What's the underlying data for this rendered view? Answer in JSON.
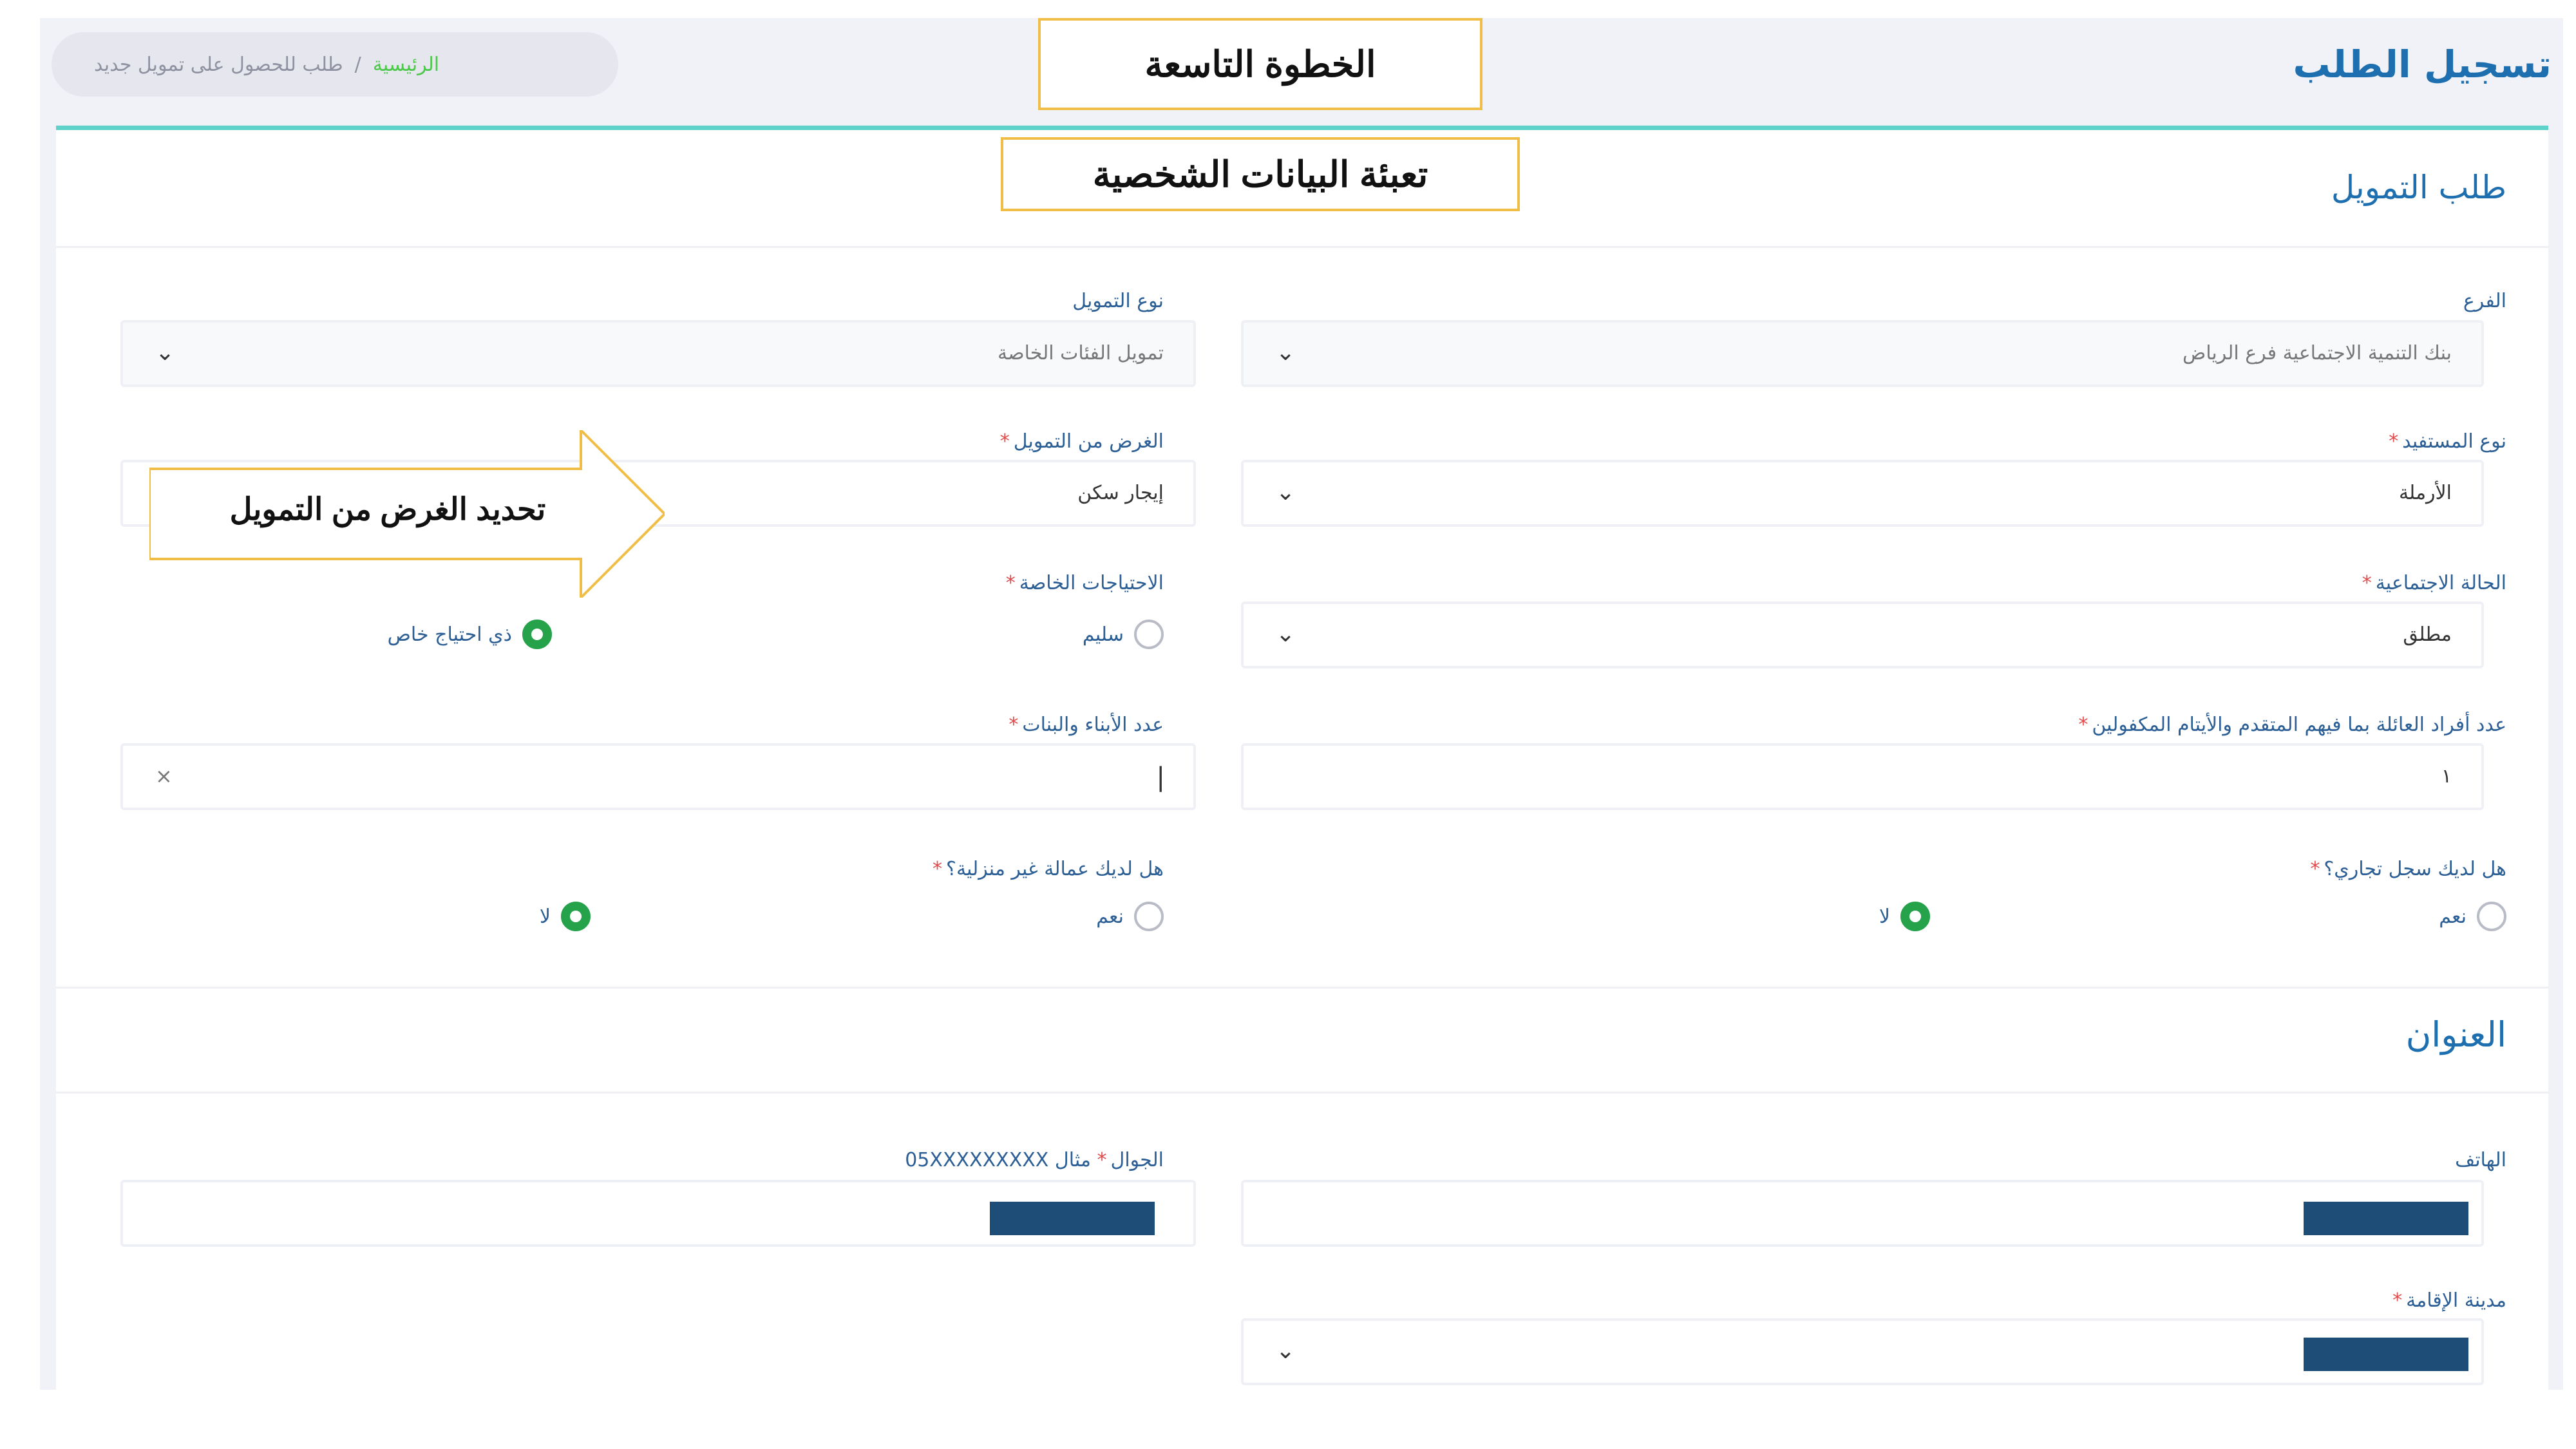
{
  "header": {
    "page_title": "تسجيل الطلب",
    "breadcrumb": {
      "home": "الرئيسية",
      "separator": "/",
      "current": "طلب للحصول على تمويل جديد"
    }
  },
  "annotations": {
    "step": "الخطوة التاسعة",
    "section_note": "تعبئة البيانات الشخصية",
    "arrow_note": "تحديد الغرض من التمويل"
  },
  "form": {
    "section_title": "طلب التمويل",
    "branch": {
      "label": "الفرع",
      "value": "بنك التنمية الاجتماعية فرع الرياض"
    },
    "financing_type": {
      "label": "نوع التمويل",
      "value": "تمويل الفئات الخاصة"
    },
    "beneficiary_type": {
      "label": "نوع المستفيد",
      "required": "*",
      "value": "الأرملة"
    },
    "financing_purpose": {
      "label": "الغرض من التمويل",
      "required": "*",
      "value": "إيجار سكن"
    },
    "marital_status": {
      "label": "الحالة الاجتماعية",
      "required": "*",
      "value": "مطلق"
    },
    "special_needs": {
      "label": "الاحتياجات الخاصة",
      "required": "*",
      "options": [
        {
          "label": "سليم",
          "selected": false
        },
        {
          "label": "ذي احتياج خاص",
          "selected": true
        }
      ]
    },
    "family_members": {
      "label": "عدد أفراد العائلة بما فيهم المتقدم والأيتام المكفولين",
      "required": "*",
      "value": "١"
    },
    "children_count": {
      "label": "عدد الأبناء والبنات",
      "required": "*",
      "value": "",
      "clear_icon": "×"
    },
    "commercial_register": {
      "label": "هل لديك سجل تجاري؟",
      "required": "*",
      "options": [
        {
          "label": "نعم",
          "selected": false
        },
        {
          "label": "لا",
          "selected": true
        }
      ]
    },
    "domestic_worker": {
      "label": "هل لديك عمالة غير منزلية؟",
      "required": "*",
      "options": [
        {
          "label": "نعم",
          "selected": false
        },
        {
          "label": "لا",
          "selected": true
        }
      ]
    }
  },
  "address": {
    "section_title": "العنوان",
    "phone": {
      "label": "الهاتف"
    },
    "mobile": {
      "label": "الجوال",
      "required": "*",
      "hint": "مثال 05XXXXXXXXX"
    },
    "city": {
      "label": "مدينة الإقامة",
      "required": "*"
    }
  },
  "icons": {
    "select": "chevron-down-icon",
    "radio": "radio-icon"
  },
  "colors": {
    "accent": "#1e6fb0",
    "selected_radio": "#25a24a",
    "required": "#e04b4b",
    "top_border": "#5fd3c9",
    "callout_border": "#f0be46",
    "redaction": "#1e4e78"
  }
}
